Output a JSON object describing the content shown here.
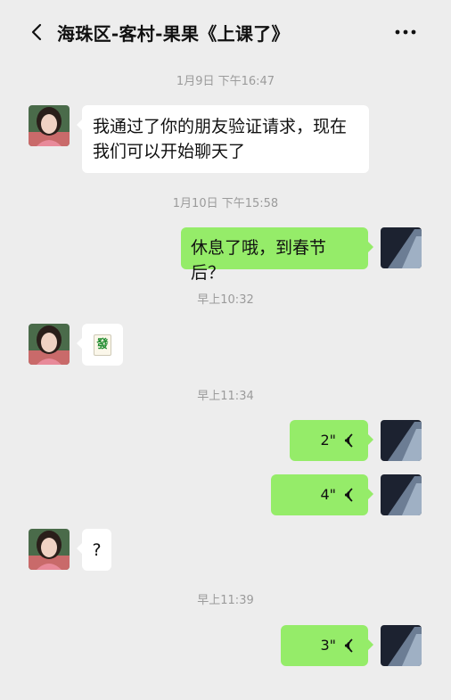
{
  "header": {
    "title": "海珠区-客村-果果《上课了》",
    "back_icon": "chevron-left-icon",
    "more_icon": "more-dots-icon"
  },
  "messages": {
    "ts1": "1月9日 下午16:47",
    "greeting": [
      "我通过了你的朋友验证请求，现在",
      "我们可以开始聊天了"
    ],
    "ts2": "1月10日 下午15:58",
    "holiday": "休息了哦，到春节后？",
    "ts3": "早上10:32",
    "emoji_tile": "發",
    "ts4": "早上11:34",
    "voice1": "2\"",
    "voice2": "4\"",
    "question": "?",
    "ts5": "早上11:39",
    "voice3": "3\""
  },
  "colors": {
    "background": "#ededed",
    "outgoing_bubble": "#95ec69",
    "incoming_bubble": "#ffffff",
    "timestamp_text": "#9b9b9b"
  }
}
